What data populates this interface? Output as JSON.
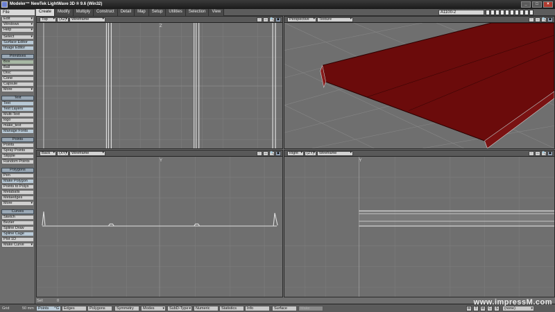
{
  "window": {
    "title": "Modeler™ NewTek LightWave 3D ® 9.6  (Win32)",
    "controls": [
      "_",
      "□",
      "×"
    ]
  },
  "tabs": [
    "Create",
    "Modify",
    "Multiply",
    "Construct",
    "Detail",
    "Map",
    "Setup",
    "Utilities",
    "Selection",
    "View"
  ],
  "active_tab": "Create",
  "layer_select": "A1100-2",
  "menus": [
    "File",
    "Edit",
    "Windows",
    "Help"
  ],
  "toolbar": {
    "top": [
      "Select",
      "Surface Editor",
      "Image Editor"
    ],
    "sections": [
      {
        "header": "Primitives",
        "items": [
          "Box",
          "Ball",
          "Disc",
          "Cone",
          "Capsule",
          "More"
        ]
      },
      {
        "header": "Text",
        "items": [
          "Text",
          "Text Layers",
          "Multi-Text",
          "logo",
          "make_text",
          "Manage Fonts"
        ]
      },
      {
        "header": "Points",
        "items": [
          "Points",
          "Spray Points",
          "Stipple",
          "Random Points"
        ]
      },
      {
        "header": "Polygons",
        "items": [
          "Pen",
          "Make Polygon",
          "Points to Polys",
          "Metaballs",
          "Metaedges",
          "More"
        ]
      },
      {
        "header": "Curves",
        "items": [
          "Sketch",
          "Bezier",
          "Spline Draw",
          "Spline Cage",
          "Plot 1D",
          "Make Curve"
        ]
      }
    ]
  },
  "viewports": {
    "top": {
      "view": "Top",
      "axes": "(XZ)",
      "mode": "Wireframe",
      "axis_label": "Z"
    },
    "perspective": {
      "view": "Perspective",
      "mode": "Texture"
    },
    "back": {
      "view": "Back",
      "axes": "(XY)",
      "mode": "Wireframe",
      "axis_label": "Y"
    },
    "right": {
      "view": "Right",
      "axes": "(ZY)",
      "mode": "Wireframe",
      "axis_label": "Y"
    }
  },
  "viewport_icon_labels": [
    "·",
    "↔",
    "🔍",
    "▣"
  ],
  "status": {
    "sel_label": "Sel:",
    "sel_value": "0",
    "grid_label": "Grid",
    "grid_value": "50 mm",
    "buttons": [
      "Points",
      "Edges",
      "Polygons",
      "Symmetry",
      "Modes",
      "SubD-Type",
      "Numeric",
      "Statistics",
      "Info",
      "Surface",
      "Make"
    ],
    "points_hotkey": "^G",
    "right_buttons": [
      "W",
      "T",
      "M",
      "C",
      "S"
    ],
    "layer": "(none)"
  },
  "watermark": "www.impressM.com",
  "colors": {
    "accent_surface": "#7a1010",
    "viewport_bg": "#6f6f6f",
    "grid_line": "#7c7c7c"
  }
}
